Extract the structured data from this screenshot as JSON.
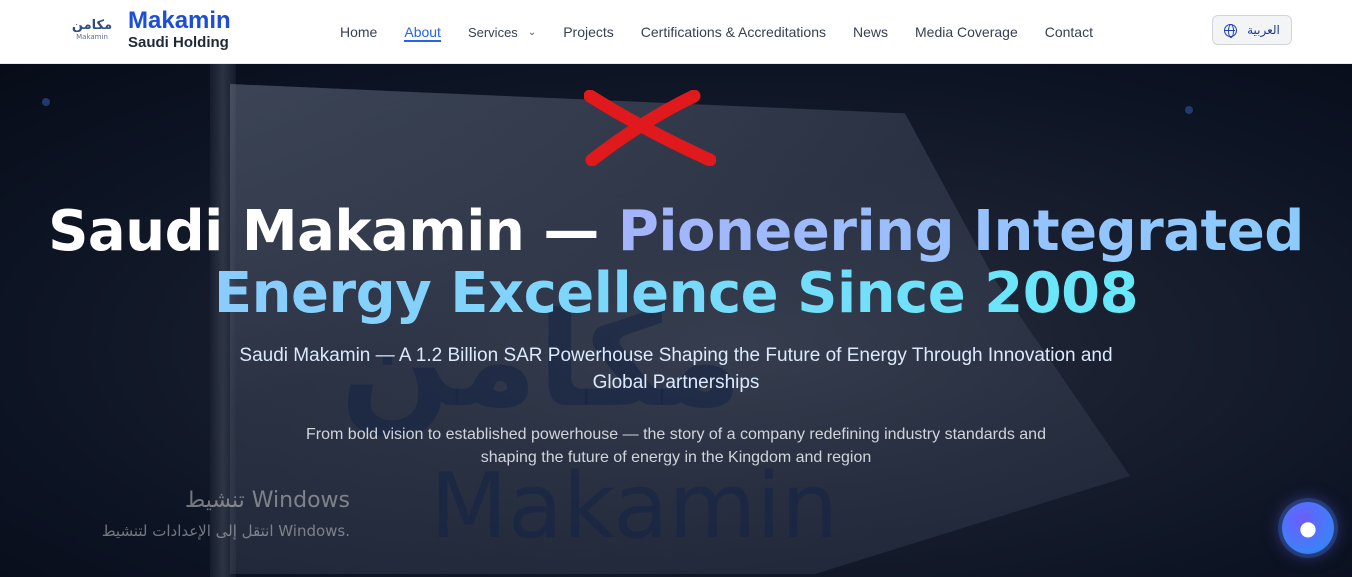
{
  "header": {
    "brand": {
      "logo_arabic": "مكامن",
      "logo_latin": "Makamin",
      "name": "Makamin",
      "subtitle": "Saudi Holding"
    },
    "nav": [
      {
        "label": "Home",
        "active": false
      },
      {
        "label": "About",
        "active": true
      },
      {
        "label": "Services",
        "active": false,
        "has_dropdown": true
      },
      {
        "label": "Projects",
        "active": false
      },
      {
        "label": "Certifications & Accreditations",
        "active": false
      },
      {
        "label": "News",
        "active": false
      },
      {
        "label": "Media Coverage",
        "active": false
      },
      {
        "label": "Contact",
        "active": false
      }
    ],
    "language_button": {
      "label": "العربية",
      "icon": "globe-icon"
    }
  },
  "hero": {
    "title_part1": "Saudi Makamin — ",
    "title_part2": "Pioneering Integrated Energy Excellence Since 2008",
    "subtitle": "Saudi Makamin — A 1.2 Billion SAR Powerhouse Shaping the Future of Energy Through Innovation and Global Partnerships",
    "description": "From bold vision to established powerhouse — the story of a company redefining industry standards and shaping the future of energy in the Kingdom and region",
    "flag_text_arabic": "مكامن",
    "flag_text_latin": "Makamin"
  },
  "overlay": {
    "windows_title": "تنشيط Windows",
    "windows_sub": "انتقل إلى الإعدادات لتنشيط Windows."
  },
  "chat": {
    "icon": "chat-bot-icon"
  },
  "colors": {
    "brand_blue": "#1d4ed8",
    "active_nav": "#2563eb",
    "title_gradient_start": "#a5b4fc",
    "title_gradient_end": "#67e8f9",
    "red_mark": "#e0191c"
  }
}
